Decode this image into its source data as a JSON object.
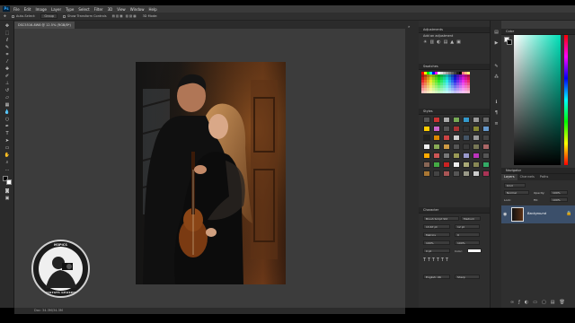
{
  "menubar": {
    "logo": "Ps",
    "items": [
      "File",
      "Edit",
      "Image",
      "Layer",
      "Type",
      "Select",
      "Filter",
      "3D",
      "View",
      "Window",
      "Help"
    ]
  },
  "options": {
    "auto_select": "Auto-Select:",
    "group": "Group",
    "transform": "Show Transform Controls",
    "mode": "3D Mode:"
  },
  "document": {
    "tab_title": "DSC5516-8W8 @ 12.5% (RGB/8*)"
  },
  "status": {
    "text": "Doc: 34.3M/34.3M"
  },
  "panels": {
    "adjustments": {
      "title": "Adjustments",
      "subtitle": "Add an adjustment"
    },
    "swatches": {
      "title": "Swatches"
    },
    "styles": {
      "title": "Styles"
    },
    "character": {
      "title": "Character",
      "font": "Brush Script Std",
      "style": "Medium",
      "size": "13.67 pt",
      "leading": "12 pt",
      "tracking": "Metrics",
      "kerning": "0",
      "scale_v": "100%",
      "scale_h": "100%",
      "baseline": "0 pt",
      "color_label": "Color:",
      "language": "English: UK",
      "aa": "Sharp"
    },
    "color": {
      "title": "Color"
    },
    "navigator": {
      "title": "Navigator"
    },
    "layers": {
      "tabs": [
        "Layers",
        "Channels",
        "Paths"
      ],
      "kind": "Kind",
      "mode": "Normal",
      "opacity_label": "Opacity:",
      "opacity": "100%",
      "lock_label": "Lock:",
      "fill_label": "Fill:",
      "fill": "100%",
      "layer_name": "Background"
    }
  },
  "watermark": {
    "top": "M3PICS",
    "bottom": "MOSTAFA GHASEMI"
  },
  "colors": {
    "swatches": [
      "#ff0000",
      "#ffff00",
      "#00ff00",
      "#00ffff",
      "#0000ff",
      "#ff00ff",
      "#ffffff",
      "#e0e0e0",
      "#c0c0c0",
      "#a0a0a0",
      "#808080",
      "#606060",
      "#404040",
      "#202020",
      "#000000",
      "#ff8080",
      "#ffc080",
      "#ffff80"
    ]
  }
}
